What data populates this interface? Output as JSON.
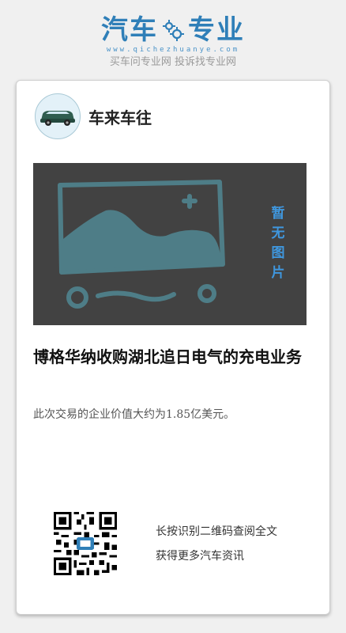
{
  "brand": {
    "logo_left": "汽车",
    "logo_right": "专业",
    "url": "www.qichezhuanye.com",
    "slogan": "买车问专业网 投诉找专业网",
    "color": "#2f7fb8"
  },
  "author": {
    "name": "车来车往",
    "avatar_icon": "car-icon"
  },
  "cover": {
    "placeholder_label": [
      "暂",
      "无",
      "图",
      "片"
    ],
    "placeholder_icon": "image-placeholder-icon"
  },
  "article": {
    "title": "博格华纳收购湖北追日电气的充电业务",
    "summary": "此次交易的企业价值大约为1.85亿美元。"
  },
  "qr": {
    "line1": "长按识别二维码查阅全文",
    "line2": "获得更多汽车资讯",
    "icon": "qr-code-icon"
  },
  "colors": {
    "background": "#f0f0f0",
    "card": "#ffffff",
    "cover_bg": "#424242",
    "cover_sketch": "#4e7d87",
    "placeholder_text": "#3f97de"
  }
}
